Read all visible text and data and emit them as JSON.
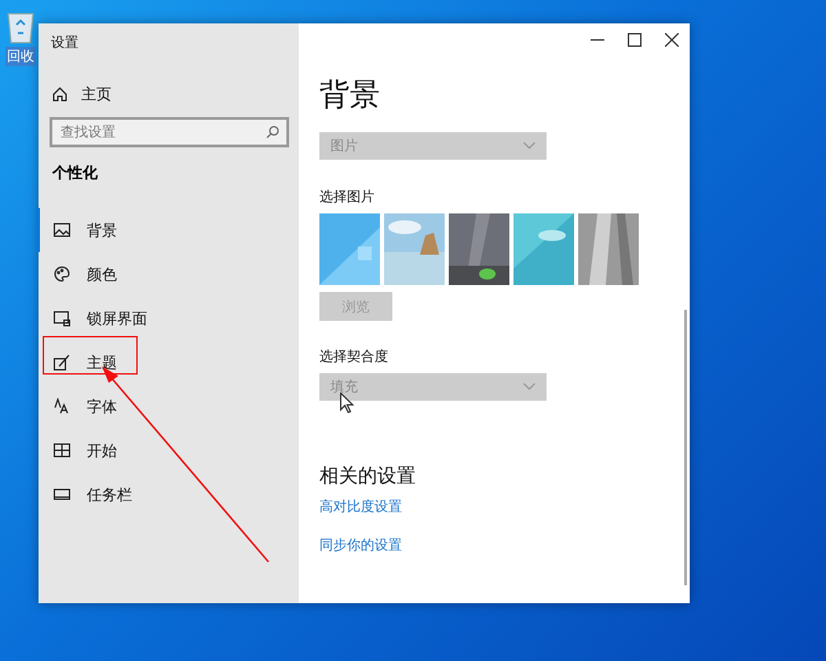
{
  "desktop": {
    "icons": [
      {
        "label": "回收"
      }
    ]
  },
  "window": {
    "title": "设置"
  },
  "sidebar": {
    "home": "主页",
    "search": {
      "placeholder": "查找设置"
    },
    "section": "个性化",
    "items": [
      {
        "label": "背景",
        "selected": true
      },
      {
        "label": "颜色",
        "selected": false
      },
      {
        "label": "锁屏界面",
        "selected": false
      },
      {
        "label": "主题",
        "selected": false
      },
      {
        "label": "字体",
        "selected": false
      },
      {
        "label": "开始",
        "selected": false
      },
      {
        "label": "任务栏",
        "selected": false
      }
    ]
  },
  "content": {
    "title": "背景",
    "background_select": {
      "value": "图片",
      "disabled": true
    },
    "choose_picture_label": "选择图片",
    "browse_button": {
      "label": "浏览",
      "disabled": true
    },
    "fit_label": "选择契合度",
    "fit_select": {
      "value": "填充",
      "disabled": true
    },
    "related_title": "相关的设置",
    "links": [
      "高对比度设置",
      "同步你的设置"
    ]
  }
}
